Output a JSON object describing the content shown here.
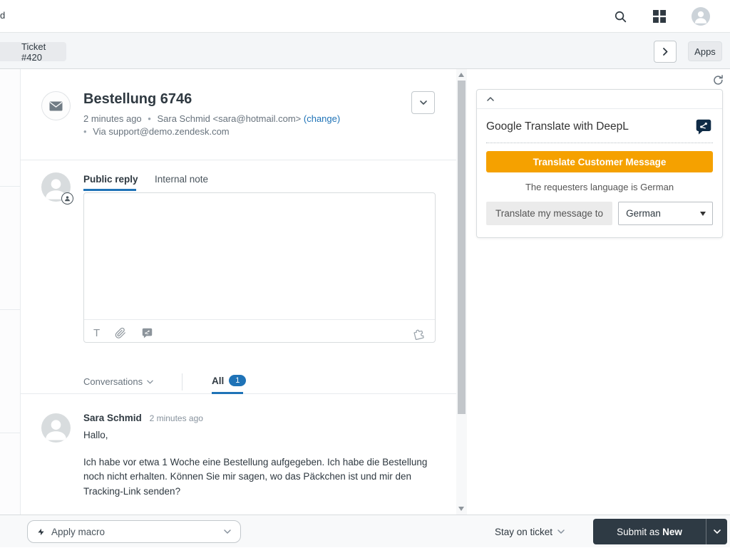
{
  "topbar": {
    "overflow_text": "d"
  },
  "tabbar": {
    "ticket_tab_label": "Ticket #420",
    "apps_button_label": "Apps"
  },
  "ticket_header": {
    "title": "Bestellung 6746",
    "timestamp": "2 minutes ago",
    "meta_separator": "•",
    "requester": "Sara Schmid <sara@hotmail.com>",
    "change_link": "(change)",
    "via": "Via support@demo.zendesk.com"
  },
  "composer": {
    "tabs": [
      {
        "label": "Public reply"
      },
      {
        "label": "Internal note"
      }
    ],
    "toolbar": {
      "text_format_glyph": "T"
    }
  },
  "conversations_bar": {
    "dropdown_label": "Conversations",
    "filter_label": "All",
    "badge_count": "1"
  },
  "message": {
    "author": "Sara Schmid",
    "timestamp": "2 minutes ago",
    "line1": "Hallo,",
    "body": "Ich habe vor etwa 1 Woche eine Bestellung aufgegeben. Ich habe die Bestellung noch nicht erhalten. Können Sie mir sagen, wo das Päckchen ist und mir den Tracking-Link senden?"
  },
  "translate_panel": {
    "app_title": "Google Translate with DeepL",
    "translate_button_label": "Translate Customer Message",
    "language_note": "The requesters language is German",
    "translate_to_button_label": "Translate my message to",
    "language_selected": "German"
  },
  "footer": {
    "apply_macro_label": "Apply macro",
    "stay_on_ticket_label": "Stay on ticket",
    "submit_label_prefix": "Submit as",
    "submit_status": "New"
  },
  "icons": {
    "search": "magnifying-glass",
    "product_grid": "four-squares",
    "user_avatar": "person-circle",
    "ticket_status": "yellow-pill",
    "email_channel": "envelope",
    "deepl": "speech-bubble-share",
    "attachment": "paperclip",
    "apps": "puzzle-piece",
    "refresh": "circular-arrow",
    "macro": "lightning-bolt"
  },
  "colors": {
    "accent_blue": "#1f73b7",
    "cta_orange": "#f5a100",
    "dark_slate": "#2f3941",
    "status_yellow": "#eec43d",
    "deepl_navy": "#0f2b46"
  }
}
